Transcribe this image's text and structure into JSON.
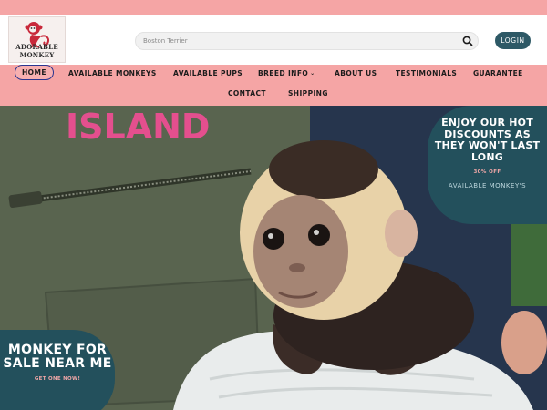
{
  "brand": {
    "logo_text": "ADORABLE MONKEY"
  },
  "search": {
    "placeholder": "Boston Terrier"
  },
  "header": {
    "login_label": "LOGIN"
  },
  "nav": {
    "row1": [
      "HOME",
      "AVAILABLE MONKEYS",
      "AVAILABLE PUPS",
      "BREED INFO",
      "ABOUT US",
      "TESTIMONIALS",
      "GUARANTEE"
    ],
    "row2": [
      "CONTACT",
      "SHIPPING"
    ],
    "active": "HOME"
  },
  "hero": {
    "vest_print": "ISLAND"
  },
  "promo_right": {
    "headline": "ENJOY OUR HOT DISCOUNTS AS THEY WON'T LAST LONG",
    "sub": "30% OFF",
    "link": "AVAILABLE MONKEY'S"
  },
  "promo_left": {
    "headline": "MONKEY FOR SALE NEAR ME",
    "cta": "GET ONE NOW!"
  },
  "colors": {
    "pink": "#f5a5a5",
    "teal": "#23505c",
    "login": "#2e5966",
    "active_border": "#2b3590"
  }
}
